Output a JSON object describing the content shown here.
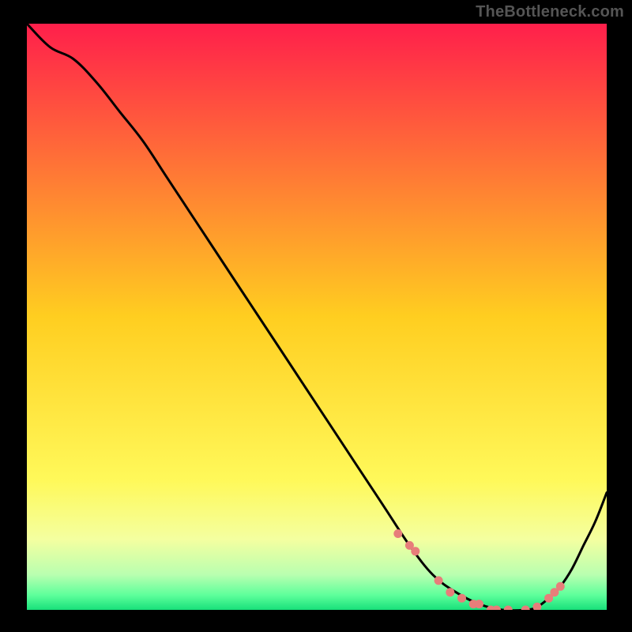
{
  "watermark": "TheBottleneck.com",
  "colors": {
    "frame": "#000000",
    "curve": "#000000",
    "markers": "#e77d7a",
    "gradient_stops": [
      {
        "pos": 0.0,
        "color": "#ff1f4b"
      },
      {
        "pos": 0.5,
        "color": "#ffce20"
      },
      {
        "pos": 0.78,
        "color": "#fff95a"
      },
      {
        "pos": 0.88,
        "color": "#f4ffa0"
      },
      {
        "pos": 0.94,
        "color": "#b9ffb0"
      },
      {
        "pos": 0.975,
        "color": "#5dff9b"
      },
      {
        "pos": 1.0,
        "color": "#18e07a"
      }
    ]
  },
  "chart_data": {
    "type": "line",
    "title": "",
    "xlabel": "",
    "ylabel": "",
    "xlim": [
      0,
      100
    ],
    "ylim": [
      0,
      100
    ],
    "series": [
      {
        "name": "curve",
        "x": [
          0,
          4,
          8,
          12,
          16,
          20,
          24,
          28,
          32,
          36,
          40,
          44,
          48,
          52,
          56,
          60,
          62,
          66,
          70,
          74,
          78,
          82,
          86,
          88,
          90,
          92,
          94,
          96,
          98,
          100
        ],
        "y": [
          100,
          96,
          94,
          90,
          85,
          80,
          74,
          68,
          62,
          56,
          50,
          44,
          38,
          32,
          26,
          20,
          17,
          11,
          6,
          3,
          1,
          0,
          0,
          0.5,
          2,
          4,
          7,
          11,
          15,
          20
        ]
      }
    ],
    "markers": {
      "name": "valley-points",
      "x": [
        64,
        66,
        67,
        71,
        73,
        75,
        77,
        78,
        80,
        81,
        83,
        86,
        88,
        90,
        91,
        92
      ],
      "y": [
        13,
        11,
        10,
        5,
        3,
        2,
        1,
        1,
        0,
        0,
        0,
        0,
        0.5,
        2,
        3,
        4
      ]
    }
  }
}
